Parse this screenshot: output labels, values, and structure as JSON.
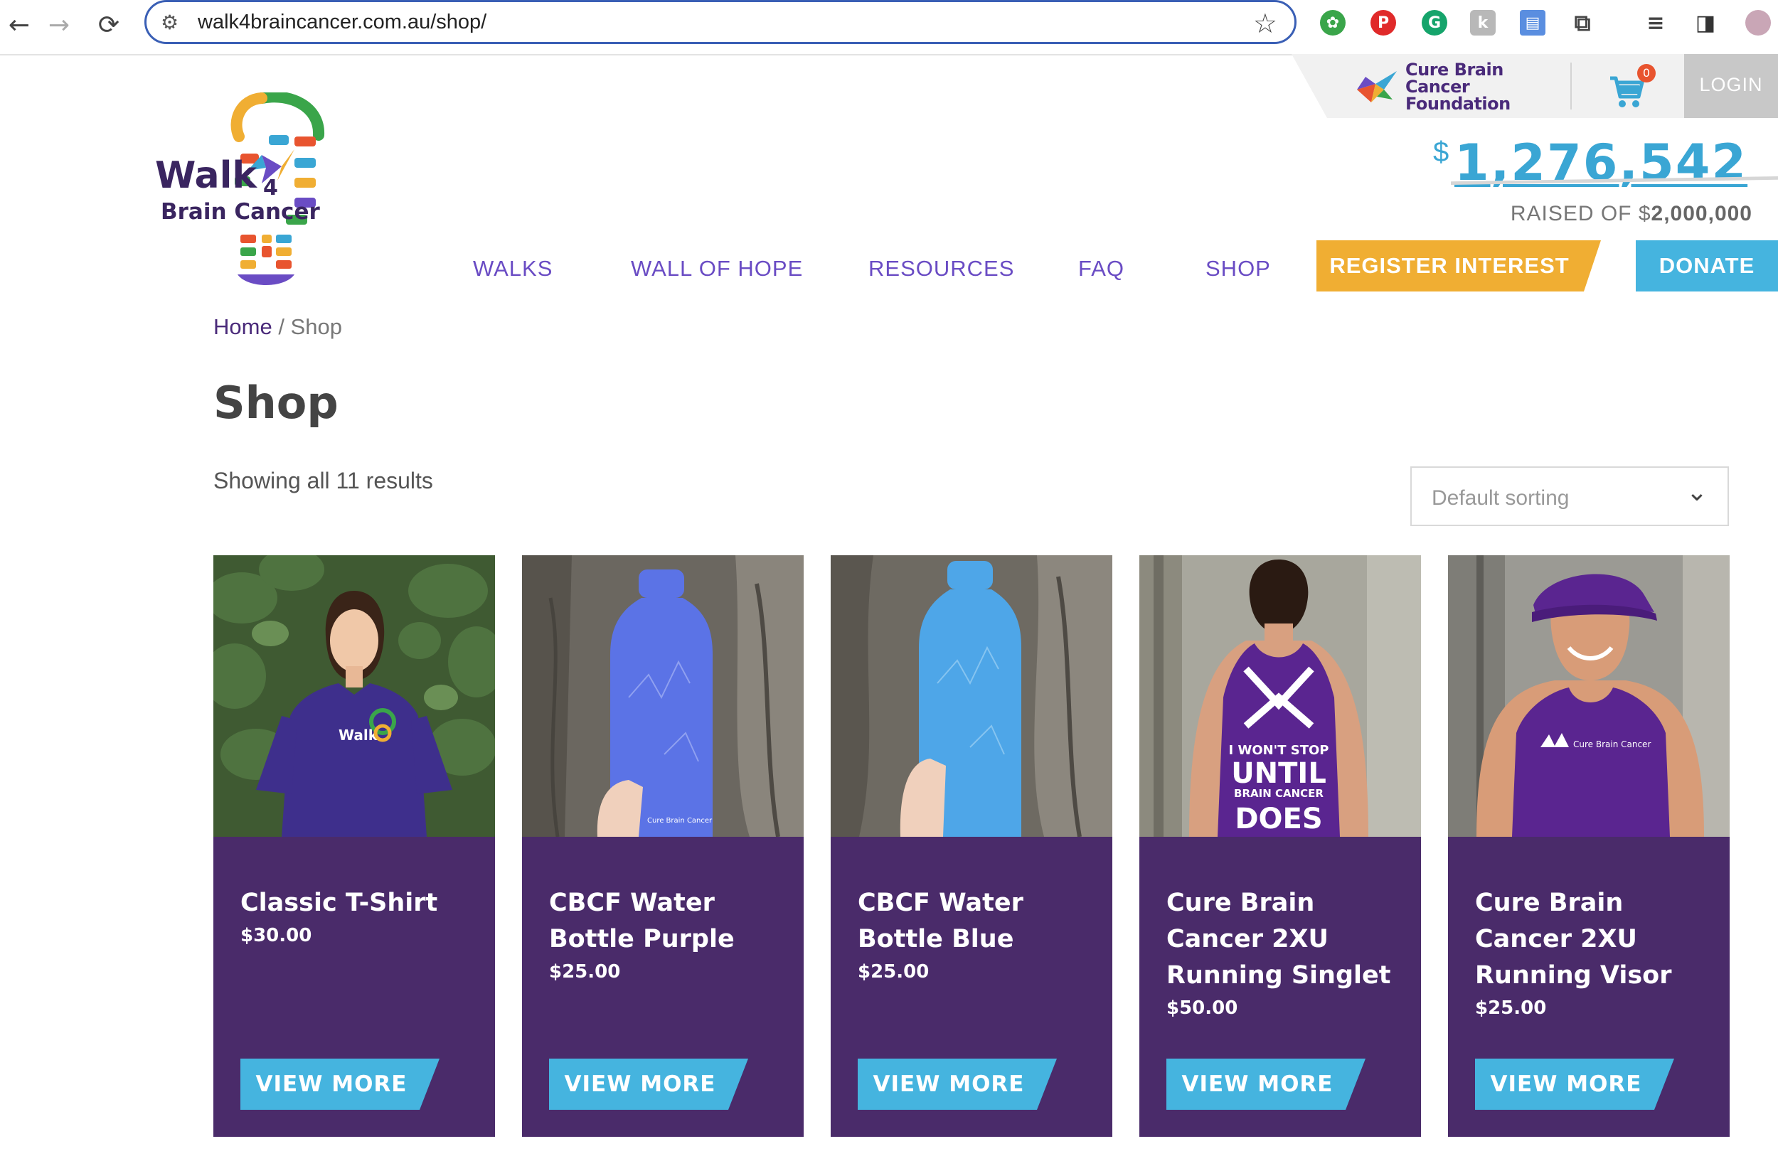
{
  "browser": {
    "url": "walk4braincancer.com.au/shop/",
    "back_icon": "←",
    "forward_icon": "→",
    "reload_icon": "⟳",
    "star_icon": "☆"
  },
  "header": {
    "cbcf_name": "Cure Brain Cancer Foundation",
    "cart_count": "0",
    "login_label": "LOGIN",
    "tally_currency": "$",
    "tally_amount": "1,276,542",
    "raised_prefix": "RAISED OF $",
    "raised_goal": "2,000,000",
    "progress_fraction": 0.638,
    "logo": {
      "line1": "Walk",
      "line1_small": "4",
      "line2": "Brain Cancer"
    }
  },
  "nav": {
    "items": [
      "WALKS",
      "WALL OF HOPE",
      "RESOURCES",
      "FAQ",
      "SHOP"
    ],
    "register_label": "REGISTER INTEREST",
    "donate_label": "DONATE"
  },
  "breadcrumb": {
    "home": "Home",
    "separator": " / ",
    "current": "Shop"
  },
  "page": {
    "title": "Shop",
    "result_count": "Showing all 11 results",
    "sort_selected": "Default sorting"
  },
  "products": [
    {
      "title": "Classic T-Shirt",
      "price": "$30.00",
      "button": "VIEW MORE",
      "image": "woman in purple t-shirt"
    },
    {
      "title": "CBCF Water Bottle Purple",
      "price": "$25.00",
      "button": "VIEW MORE",
      "image": "purple water bottle"
    },
    {
      "title": "CBCF Water Bottle Blue",
      "price": "$25.00",
      "button": "VIEW MORE",
      "image": "blue water bottle"
    },
    {
      "title": "Cure Brain Cancer 2XU Running Singlet",
      "price": "$50.00",
      "button": "VIEW MORE",
      "image": "purple running singlet back"
    },
    {
      "title": "Cure Brain Cancer 2XU Running Visor",
      "price": "$25.00",
      "button": "VIEW MORE",
      "image": "man in purple visor"
    }
  ],
  "product_images_text": {
    "singlet_line1": "I WON'T STOP",
    "singlet_line2": "UNTIL",
    "singlet_line3": "BRAIN CANCER",
    "singlet_line4": "DOES"
  },
  "colors": {
    "brand_purple": "#4a2b6a",
    "nav_purple": "#6a4cc4",
    "accent_blue": "#45b4df",
    "accent_orange": "#f0ae33"
  }
}
